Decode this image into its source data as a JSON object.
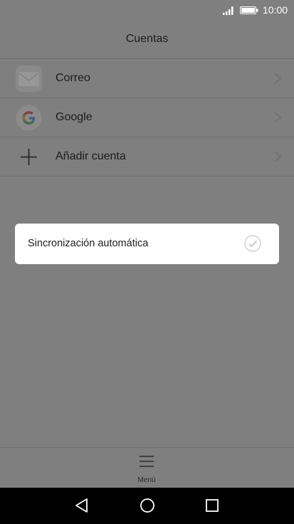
{
  "status_bar": {
    "time": "10:00",
    "signal_icon": "signal-icon",
    "battery_icon": "battery-icon"
  },
  "header": {
    "title": "Cuentas"
  },
  "accounts": [
    {
      "label": "Correo",
      "icon": "mail-icon"
    },
    {
      "label": "Google",
      "icon": "google-icon"
    },
    {
      "label": "Añadir cuenta",
      "icon": "plus-icon"
    }
  ],
  "dialog": {
    "label": "Sincronización automática",
    "checked": true,
    "check_icon": "checkmark-icon"
  },
  "bottom_menu": {
    "label": "Menú",
    "icon": "hamburger-icon"
  },
  "nav_bar": {
    "back_icon": "back-triangle-icon",
    "home_icon": "home-circle-icon",
    "recents_icon": "recents-square-icon"
  },
  "colors": {
    "overlay": "#7f7f7f",
    "dialog_bg": "#ffffff",
    "nav_bg": "#000000"
  }
}
